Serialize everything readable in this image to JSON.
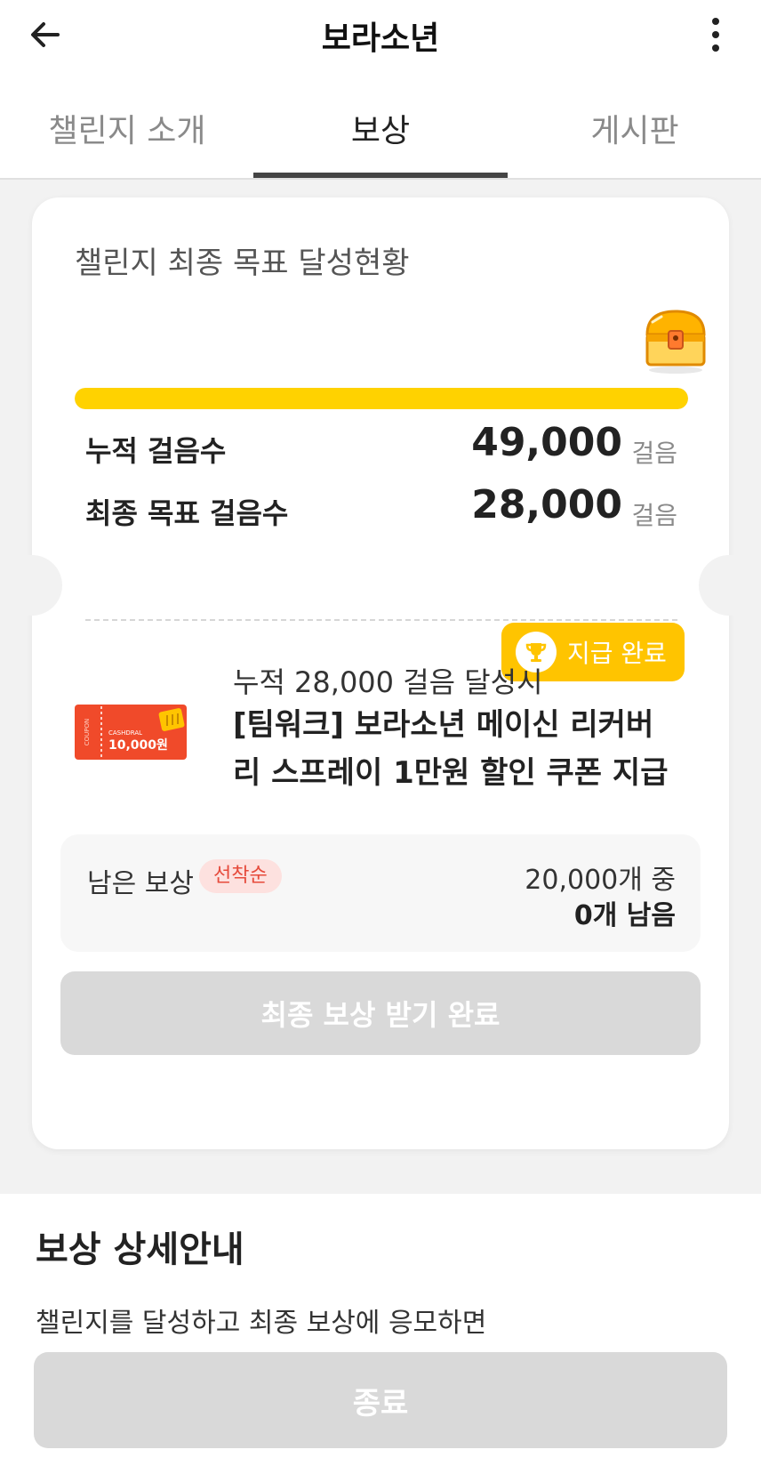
{
  "header": {
    "title": "보라소년"
  },
  "tabs": [
    {
      "label": "챌린지 소개"
    },
    {
      "label": "보상"
    },
    {
      "label": "게시판"
    }
  ],
  "goal_card": {
    "title": "챌린지 최종 목표 달성현황",
    "progress_percent": 100,
    "stats": [
      {
        "label": "누적 걸음수",
        "value": "49,000",
        "unit": "걸음"
      },
      {
        "label": "최종 목표 걸음수",
        "value": "28,000",
        "unit": "걸음"
      }
    ]
  },
  "reward": {
    "badge": "지급 완료",
    "condition": "누적 28,000 걸음 달성시",
    "name": "[팀워크] 보라소년 메이신 리커버리 스프레이 1만원 할인 쿠폰 지급",
    "coupon": {
      "brand": "CASHDRAL",
      "amount": "10,000원",
      "side": "COUPON"
    },
    "remaining_label": "남은 보상",
    "remaining_badge": "선착순",
    "remaining_total": "20,000개 중",
    "remaining_left": "0개 남음",
    "claim_button": "최종 보상 받기 완료"
  },
  "detail": {
    "title": "보상 상세안내",
    "description": "챌린지를 달성하고 최종 보상에 응모하면",
    "end_button": "종료"
  },
  "colors": {
    "accent": "#ffd200",
    "badge": "#ffc400",
    "disabled": "#d9d9d9",
    "coupon": "#f04a2a"
  }
}
